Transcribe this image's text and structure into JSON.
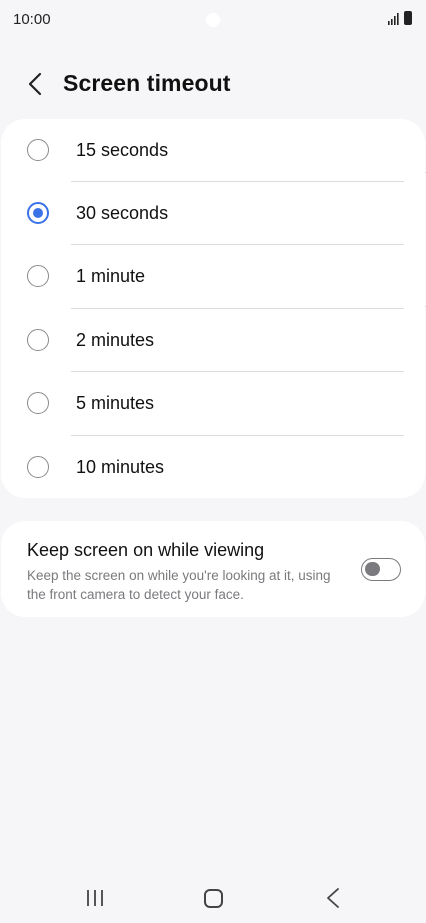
{
  "status_bar": {
    "time": "10:00"
  },
  "header": {
    "title": "Screen timeout"
  },
  "options": [
    {
      "label": "15 seconds",
      "selected": false
    },
    {
      "label": "30 seconds",
      "selected": true
    },
    {
      "label": "1 minute",
      "selected": false
    },
    {
      "label": "2 minutes",
      "selected": false
    },
    {
      "label": "5 minutes",
      "selected": false
    },
    {
      "label": "10 minutes",
      "selected": false
    }
  ],
  "keep_screen_on": {
    "title": "Keep screen on while viewing",
    "description": "Keep the screen on while you're looking at it, using the front camera to detect your face.",
    "enabled": false
  },
  "colors": {
    "accent": "#3a72e8",
    "background": "#f6f6f8",
    "card": "#ffffff"
  },
  "icons": {
    "back": "chevron-left-icon",
    "signal": "signal-icon",
    "battery": "battery-icon",
    "nav_recents": "recents-icon",
    "nav_home": "home-icon",
    "nav_back": "nav-back-icon"
  }
}
